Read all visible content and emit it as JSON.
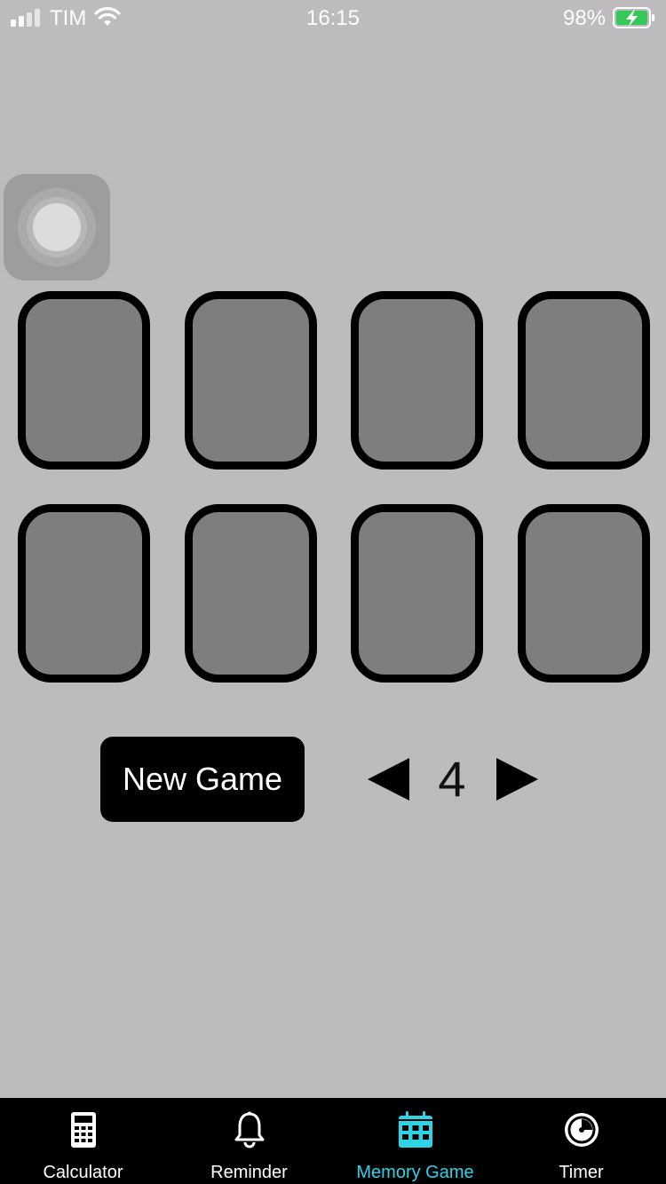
{
  "status_bar": {
    "carrier": "TIM",
    "time": "16:15",
    "battery_percent": "98%"
  },
  "game": {
    "card_count": 8,
    "new_game_label": "New Game",
    "pair_count": "4"
  },
  "tabs": [
    {
      "label": "Calculator",
      "icon": "calculator-icon",
      "active": false
    },
    {
      "label": "Reminder",
      "icon": "bell-icon",
      "active": false
    },
    {
      "label": "Memory Game",
      "icon": "calendar-grid-icon",
      "active": true
    },
    {
      "label": "Timer",
      "icon": "timer-icon",
      "active": false
    }
  ],
  "colors": {
    "background": "#bdbbbe",
    "card_back": "#7e7d80",
    "active_tab": "#2fd3e6"
  }
}
